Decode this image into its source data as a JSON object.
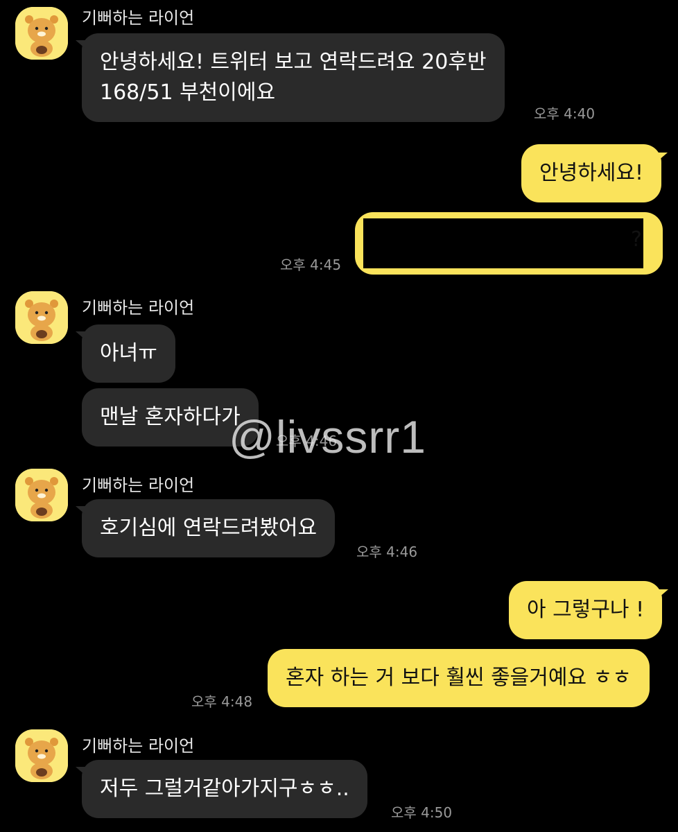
{
  "sender": {
    "name": "기뻐하는 라이언",
    "avatar_icon": "ryan-lion-icon"
  },
  "messages": [
    {
      "text_lines": [
        "안녕하세요! 트위터 보고 연락드려요 20후반",
        "168/51 부천이에요"
      ],
      "time": "오후 4:40"
    },
    {
      "text": "안녕하세요!"
    },
    {
      "text": "?",
      "time": "오후 4:45"
    },
    {
      "text": "아녀ㅠ"
    },
    {
      "text": "맨날 혼자하다가",
      "time": "오후 4:46"
    },
    {
      "text": "호기심에 연락드려봤어요",
      "time": "오후 4:46"
    },
    {
      "text": "아 그렇구나 !"
    },
    {
      "text": "혼자 하는 거 보다 훨씬 좋을거예요 ㅎㅎ",
      "time": "오후 4:48"
    },
    {
      "text": "저두 그럴거같아가지구ㅎㅎ..",
      "time": "오후 4:50"
    }
  ],
  "watermark": "@livssrr1",
  "colors": {
    "background": "#000000",
    "incoming_bubble": "#2a2a2a",
    "outgoing_bubble": "#fae35b",
    "timestamp": "#9a9a9a"
  }
}
